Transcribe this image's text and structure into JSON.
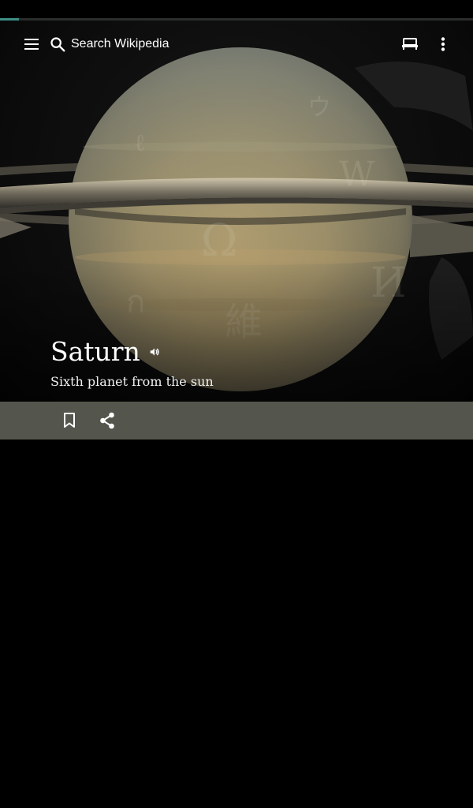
{
  "toolbar": {
    "search_placeholder": "Search Wikipedia",
    "menu_icon": "hamburger-menu-icon",
    "search_icon": "search-icon",
    "reading_lists_icon": "reading-list-icon",
    "overflow_icon": "more-vert-icon"
  },
  "load_progress": 0.04,
  "article": {
    "title": "Saturn",
    "description": "Sixth planet from the sun",
    "audio_icon": "volume-icon"
  },
  "actions": {
    "bookmark_icon": "bookmark-icon",
    "share_icon": "share-icon"
  },
  "colors": {
    "progress": "#3f8f86",
    "action_bar": "#54554c",
    "background": "#000000"
  }
}
